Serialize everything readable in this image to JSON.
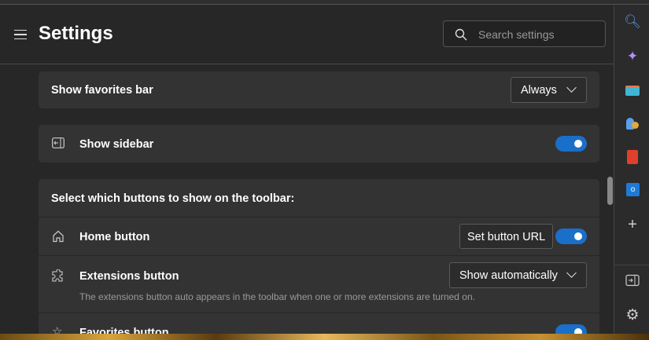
{
  "header": {
    "title": "Settings",
    "search_placeholder": "Search settings"
  },
  "favorites_bar": {
    "label": "Show favorites bar",
    "value": "Always"
  },
  "sidebar_setting": {
    "label": "Show sidebar",
    "enabled": true
  },
  "toolbar_section": {
    "heading": "Select which buttons to show on the toolbar:",
    "home": {
      "label": "Home button",
      "button": "Set button URL",
      "enabled": true
    },
    "extensions": {
      "label": "Extensions button",
      "value": "Show automatically",
      "description": "The extensions button auto appears in the toolbar when one or more extensions are turned on."
    },
    "favorites": {
      "label": "Favorites button",
      "enabled": true
    }
  },
  "right_sidebar": {
    "icons": [
      "search-icon",
      "copilot-icon",
      "tools-icon",
      "people-icon",
      "office-icon",
      "outlook-icon",
      "add-icon",
      "hide-sidebar-icon",
      "settings-icon"
    ]
  },
  "colors": {
    "accent": "#1a6fc9",
    "background": "#272727",
    "card": "#333333"
  }
}
